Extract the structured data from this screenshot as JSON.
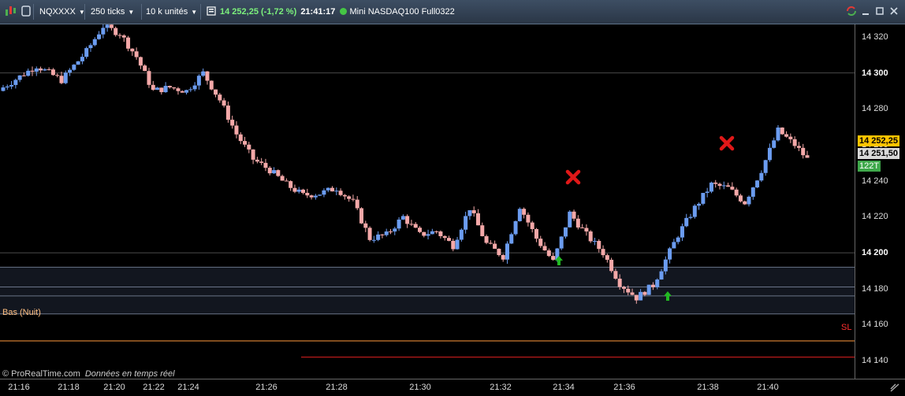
{
  "toolbar": {
    "symbol": "NQXXXX",
    "ticks": "250 ticks",
    "units": "10 k unités",
    "last_price": "14 252,25",
    "change": "(-1,72 %)",
    "time": "21:41:17",
    "instrument": "Mini NASDAQ100 Full0322"
  },
  "overlay": {
    "bas_label": "Bas (Nuit)",
    "sl_label": "SL",
    "footer_brand": "© ProRealTime.com",
    "footer_status": "Données en temps réel"
  },
  "price_tags": {
    "last": "14 252,25",
    "level": "14 251,50",
    "ticks_left": "122T"
  },
  "colors": {
    "bull": "#6b9cf0",
    "bear": "#f4a8a8",
    "bas_line": "#ff9a3c",
    "sl_line": "#e02020",
    "arrow": "#22b822",
    "cross": "#e01818"
  },
  "chart_data": {
    "type": "candlestick",
    "ylim": [
      14130,
      14327
    ],
    "y_ticks": [
      "14 140",
      "14 160",
      "14 180",
      "14 200",
      "14 220",
      "14 240",
      "14 260",
      "14 280",
      "14 300",
      "14 320"
    ],
    "y_major": [
      "14 200",
      "14 300"
    ],
    "x_ticks": [
      "21:16",
      "21:18",
      "21:20",
      "21:22",
      "21:24",
      "21:26",
      "21:28",
      "21:30",
      "21:32",
      "21:34",
      "21:36",
      "21:38",
      "21:40"
    ],
    "close_path": [
      [
        0,
        14292
      ],
      [
        8,
        14304
      ],
      [
        14,
        14296
      ],
      [
        20,
        14312
      ],
      [
        24,
        14326
      ],
      [
        28,
        14322
      ],
      [
        32,
        14309
      ],
      [
        36,
        14290
      ],
      [
        40,
        14292
      ],
      [
        44,
        14290
      ],
      [
        48,
        14300
      ],
      [
        52,
        14285
      ],
      [
        56,
        14266
      ],
      [
        60,
        14252
      ],
      [
        64,
        14246
      ],
      [
        68,
        14238
      ],
      [
        72,
        14232
      ],
      [
        76,
        14233
      ],
      [
        80,
        14236
      ],
      [
        84,
        14228
      ],
      [
        88,
        14208
      ],
      [
        92,
        14210
      ],
      [
        96,
        14220
      ],
      [
        100,
        14210
      ],
      [
        104,
        14212
      ],
      [
        108,
        14204
      ],
      [
        112,
        14225
      ],
      [
        116,
        14205
      ],
      [
        120,
        14198
      ],
      [
        124,
        14226
      ],
      [
        128,
        14208
      ],
      [
        132,
        14195
      ],
      [
        134,
        14208
      ],
      [
        136,
        14222
      ],
      [
        140,
        14210
      ],
      [
        144,
        14200
      ],
      [
        148,
        14183
      ],
      [
        152,
        14175
      ],
      [
        156,
        14182
      ],
      [
        162,
        14210
      ],
      [
        166,
        14225
      ],
      [
        170,
        14238
      ],
      [
        174,
        14236
      ],
      [
        178,
        14228
      ],
      [
        182,
        14246
      ],
      [
        186,
        14268
      ],
      [
        190,
        14260
      ],
      [
        193,
        14252
      ]
    ],
    "sma_levels": [
      14192,
      14181,
      14176,
      14166
    ],
    "bas_nuit": 14151,
    "stop_loss": 14142,
    "last": 14252.25,
    "level": 14251.5
  }
}
